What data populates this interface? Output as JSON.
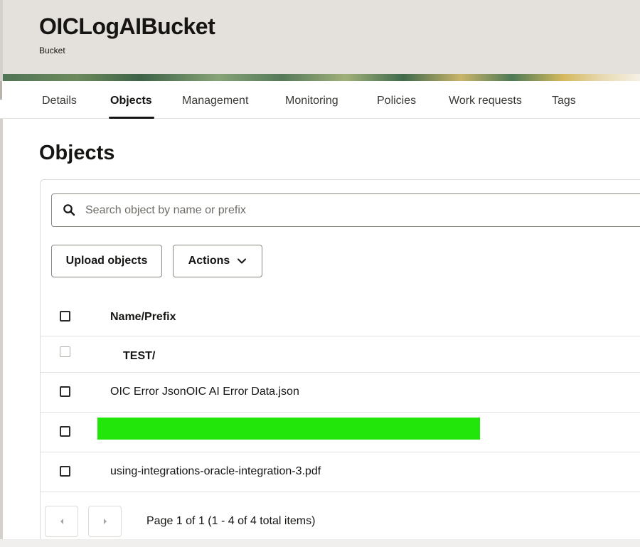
{
  "header": {
    "title": "OICLogAIBucket",
    "subtitle": "Bucket"
  },
  "tabs": [
    {
      "label": "Details",
      "active": false
    },
    {
      "label": "Objects",
      "active": true
    },
    {
      "label": "Management",
      "active": false
    },
    {
      "label": "Monitoring",
      "active": false
    },
    {
      "label": "Policies",
      "active": false
    },
    {
      "label": "Work requests",
      "active": false
    },
    {
      "label": "Tags",
      "active": false
    }
  ],
  "section": {
    "title": "Objects"
  },
  "search": {
    "placeholder": "Search object by name or prefix",
    "value": "",
    "icon": "search-icon"
  },
  "toolbar": {
    "upload_label": "Upload objects",
    "actions_label": "Actions",
    "actions_icon": "chevron-down-icon"
  },
  "table": {
    "header": "Name/Prefix",
    "rows": [
      {
        "name": "TEST/",
        "type": "prefix",
        "checkbox_enabled": false
      },
      {
        "name": "OIC Error JsonOIC AI Error Data.json",
        "type": "object",
        "checkbox_enabled": true
      },
      {
        "name": "",
        "type": "object",
        "redacted": true,
        "checkbox_enabled": true
      },
      {
        "name": "using-integrations-oracle-integration-3.pdf",
        "type": "object",
        "checkbox_enabled": true
      }
    ]
  },
  "pagination": {
    "text": "Page 1 of 1 (1 - 4 of 4 total items)",
    "prev_icon": "caret-left-icon",
    "next_icon": "caret-right-icon"
  },
  "colors": {
    "redaction": "#22e50a",
    "header_bg": "#e4e1dc",
    "text": "#161513"
  }
}
